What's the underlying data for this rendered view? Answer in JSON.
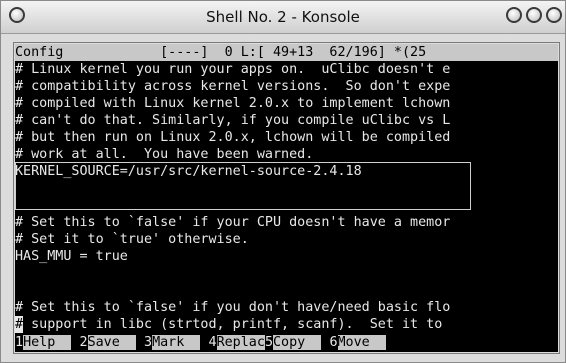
{
  "window": {
    "title": "Shell No. 2 - Konsole",
    "menu_icon": "window-menu-icon",
    "minimize_icon": "minimize-icon",
    "maximize_icon": "maximize-icon",
    "close_icon": "close-icon"
  },
  "editor": {
    "status_bar": "Config            [----]  0 L:[ 49+13  62/196] *(25",
    "lines": [
      "# Linux kernel you run your apps on.  uClibc doesn't e",
      "# compatibility across kernel versions.  So don't expe",
      "# compiled with Linux kernel 2.0.x to implement lchown",
      "# can't do that. Similarly, if you compile uClibc vs L",
      "# but then run on Linux 2.0.x, lchown will be compiled",
      "# work at all.  You have been warned.",
      "KERNEL_SOURCE=/usr/src/kernel-source-2.4.18",
      "",
      "# Set this to `false' if your CPU doesn't have a memor",
      "# Set it to `true' otherwise.",
      "HAS_MMU = true",
      "",
      "# Set this to `false' if you don't have/need basic flo"
    ],
    "cursor_char": "#",
    "cursor_line_rest": " support in libc (strtod, printf, scanf).  Set it to "
  },
  "function_keys": [
    {
      "num": "1",
      "label": "Help  "
    },
    {
      "num": "2",
      "label": "Save  "
    },
    {
      "num": "3",
      "label": "Mark  "
    },
    {
      "num": "4",
      "label": "Replac"
    },
    {
      "num": "5",
      "label": "Copy  "
    },
    {
      "num": "6",
      "label": "Move  "
    }
  ]
}
